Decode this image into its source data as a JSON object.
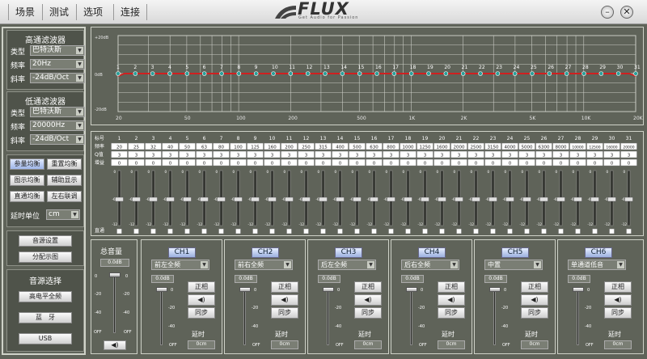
{
  "menu": {
    "items": [
      "场景",
      "测试",
      "选项",
      "连接"
    ]
  },
  "logo": {
    "word": "FLUX",
    "sub": "Get Audio for Passion"
  },
  "window": {
    "minimize_icon": "minimize-icon",
    "close_icon": "close-icon"
  },
  "left": {
    "hpf": {
      "title": "高通滤波器",
      "type_label": "类型",
      "type_value": "巴特沃斯",
      "freq_label": "频率",
      "freq_value": "20Hz",
      "slope_label": "斜率",
      "slope_value": "-24dB/Oct"
    },
    "lpf": {
      "title": "低通滤波器",
      "type_label": "类型",
      "type_value": "巴特沃斯",
      "freq_label": "频率",
      "freq_value": "20000Hz",
      "slope_label": "斜率",
      "slope_value": "-24dB/Oct"
    },
    "buttons": {
      "param_eq": "参量均衡",
      "reset_eq": "重置均衡",
      "graphic_eq": "图示均衡",
      "aux_display": "辅助显示",
      "pass_eq": "直通均衡",
      "lr_link": "左右联调"
    },
    "delay_unit_label": "延时单位",
    "delay_unit_value": "cm",
    "sound_settings": "音源设置",
    "dist_diagram": "分配示图",
    "source_title": "音源选择",
    "source_hi": "高电平全频",
    "source_bt": "蓝　牙",
    "source_usb": "USB"
  },
  "graph": {
    "y_top": "+20dB",
    "y_mid": "0dB",
    "y_bot": "-20dB",
    "x_labels": [
      "20",
      "50",
      "100",
      "200",
      "500",
      "1K",
      "2K",
      "5K",
      "10K",
      "20K"
    ],
    "points": [
      "1",
      "2",
      "3",
      "4",
      "5",
      "6",
      "7",
      "8",
      "9",
      "10",
      "11",
      "12",
      "13",
      "14",
      "15",
      "16",
      "17",
      "18",
      "19",
      "20",
      "21",
      "22",
      "23",
      "24",
      "25",
      "26",
      "27",
      "28",
      "29",
      "30",
      "31"
    ]
  },
  "eq": {
    "row_labels": {
      "num": "标号",
      "freq": "频率",
      "q": "Q值",
      "gain": "增益"
    },
    "nums": [
      "1",
      "2",
      "3",
      "4",
      "5",
      "6",
      "7",
      "8",
      "9",
      "10",
      "11",
      "12",
      "13",
      "14",
      "15",
      "16",
      "17",
      "18",
      "19",
      "20",
      "21",
      "22",
      "23",
      "24",
      "25",
      "26",
      "27",
      "28",
      "29",
      "30",
      "31"
    ],
    "freqs": [
      "20",
      "25",
      "32",
      "40",
      "50",
      "63",
      "80",
      "100",
      "125",
      "160",
      "200",
      "250",
      "315",
      "400",
      "500",
      "630",
      "800",
      "1000",
      "1250",
      "1600",
      "2000",
      "2500",
      "3150",
      "4000",
      "5000",
      "6300",
      "8000",
      "10000",
      "12500",
      "16000",
      "20000"
    ],
    "q": "3",
    "gain": "0",
    "bypass_label": "直通",
    "scale": [
      "0",
      "-6",
      "-12"
    ]
  },
  "master": {
    "title": "总音量",
    "value": "0.0dB",
    "scale_l": [
      "0",
      "-20",
      "-40",
      "OFF"
    ],
    "scale_r": [
      "0",
      "-20",
      "-40",
      "OFF"
    ],
    "volume_icon": "speaker-icon"
  },
  "channels": [
    {
      "name": "CH1",
      "source": "前左全频",
      "value": "0.0dB",
      "delay": "0cm"
    },
    {
      "name": "CH2",
      "source": "前右全频",
      "value": "0.0dB",
      "delay": "0cm"
    },
    {
      "name": "CH3",
      "source": "后左全频",
      "value": "0.0dB",
      "delay": "0cm"
    },
    {
      "name": "CH4",
      "source": "后右全频",
      "value": "0.0dB",
      "delay": "0cm"
    },
    {
      "name": "CH5",
      "source": "中置",
      "value": "0.0dB",
      "delay": "0cm"
    },
    {
      "name": "CH6",
      "source": "单通道低音",
      "value": "0.0dB",
      "delay": "0cm"
    }
  ],
  "channel_common": {
    "phase": "正相",
    "sync": "同步",
    "delay_label": "延时",
    "scale": [
      "0",
      "-20",
      "-40",
      "OFF"
    ],
    "mute_icon": "speaker-icon"
  },
  "colors": {
    "bg": "#5f6359",
    "curve": "#d02020",
    "node": "#2aa09a"
  }
}
